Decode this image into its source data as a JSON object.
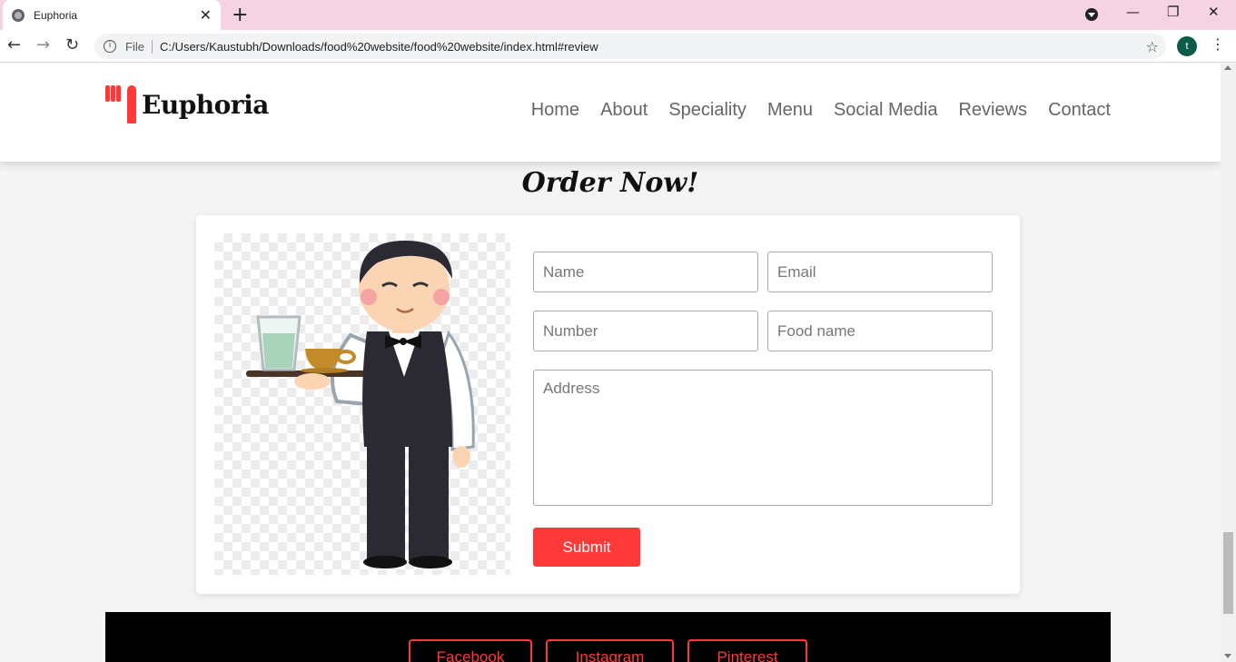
{
  "browser": {
    "tab_title": "Euphoria",
    "close_glyph": "✕",
    "new_tab_glyph": "+",
    "file_label": "File",
    "url": "C:/Users/Kaustubh/Downloads/food%20website/food%20website/index.html#review",
    "avatar_letter": "t",
    "star_glyph": "☆",
    "info_glyph": "i",
    "back_glyph": "←",
    "forward_glyph": "→",
    "reload_glyph": "↻",
    "menu_glyph": "⋮",
    "minimize_glyph": "—",
    "restore_glyph": "❐",
    "window_close_glyph": "✕"
  },
  "header": {
    "brand": "Euphoria",
    "nav": [
      "Home",
      "About",
      "Speciality",
      "Menu",
      "Social Media",
      "Reviews",
      "Contact"
    ]
  },
  "order": {
    "title": "Order Now!",
    "placeholders": {
      "name": "Name",
      "email": "Email",
      "number": "Number",
      "food": "Food name",
      "address": "Address"
    },
    "submit_label": "Submit"
  },
  "footer": {
    "social": [
      "Facebook",
      "Instagram",
      "Pinterest"
    ]
  },
  "colors": {
    "accent": "#ff3838",
    "tabstrip": "#f6d3e3"
  }
}
